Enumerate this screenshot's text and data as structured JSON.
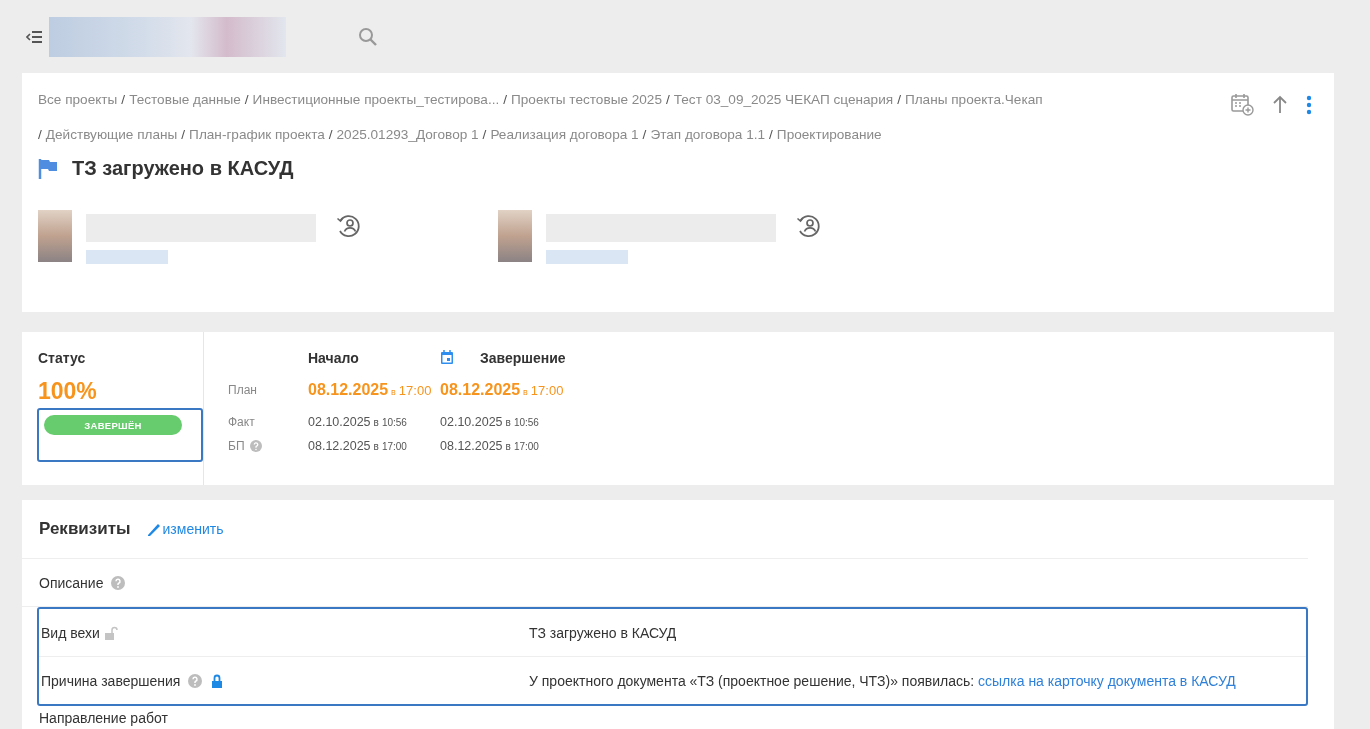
{
  "breadcrumbs": {
    "separator": "/",
    "lines": [
      [
        "Все проекты",
        "Тестовые данные",
        "Инвестиционные проекты_тестирова...",
        "Проекты тестовые 2025",
        "Тест 03_09_2025 ЧЕКАП сценария",
        "Планы проекта.Чекап"
      ],
      [
        "Действующие планы",
        "План-график проекта",
        "2025.01293_Договор 1",
        "Реализация договора 1",
        "Этап договора 1.1",
        "Проектирование"
      ]
    ]
  },
  "title": "ТЗ загружено в КАСУД",
  "status": {
    "label": "Статус",
    "percent": "100%",
    "badge": "ЗАВЕРШЁН",
    "highlighted": true
  },
  "dates": {
    "columns": [
      "Начало",
      "Завершение"
    ],
    "rows": [
      {
        "kind": "plan",
        "label": "План",
        "help": false,
        "values": [
          {
            "date": "08.12.2025",
            "at": "в",
            "time": "17:00"
          },
          {
            "date": "08.12.2025",
            "at": "в",
            "time": "17:00"
          }
        ]
      },
      {
        "kind": "fact",
        "label": "Факт",
        "help": false,
        "values": [
          {
            "date": "02.10.2025",
            "at": "в",
            "time": "10:56"
          },
          {
            "date": "02.10.2025",
            "at": "в",
            "time": "10:56"
          }
        ]
      },
      {
        "kind": "fact",
        "label": "БП",
        "help": true,
        "values": [
          {
            "date": "08.12.2025",
            "at": "в",
            "time": "17:00"
          },
          {
            "date": "08.12.2025",
            "at": "в",
            "time": "17:00"
          }
        ]
      }
    ]
  },
  "properties": {
    "title": "Реквизиты",
    "edit_link": "изменить",
    "rows": [
      {
        "label": "Описание",
        "help": true,
        "highlighted": false
      },
      {
        "label": "Вид вехи",
        "help": false,
        "locked": false,
        "highlighted": true,
        "value": "ТЗ загружено в КАСУД"
      },
      {
        "label": "Причина завершения",
        "help": true,
        "locked": true,
        "highlighted": true,
        "value": "У проектного документа «ТЗ (проектное решение, ЧТЗ)» появилась:",
        "link": "ссылка на карточку документа в КАСУД"
      },
      {
        "label": "Направление работ",
        "help": false,
        "highlighted": false
      }
    ]
  }
}
